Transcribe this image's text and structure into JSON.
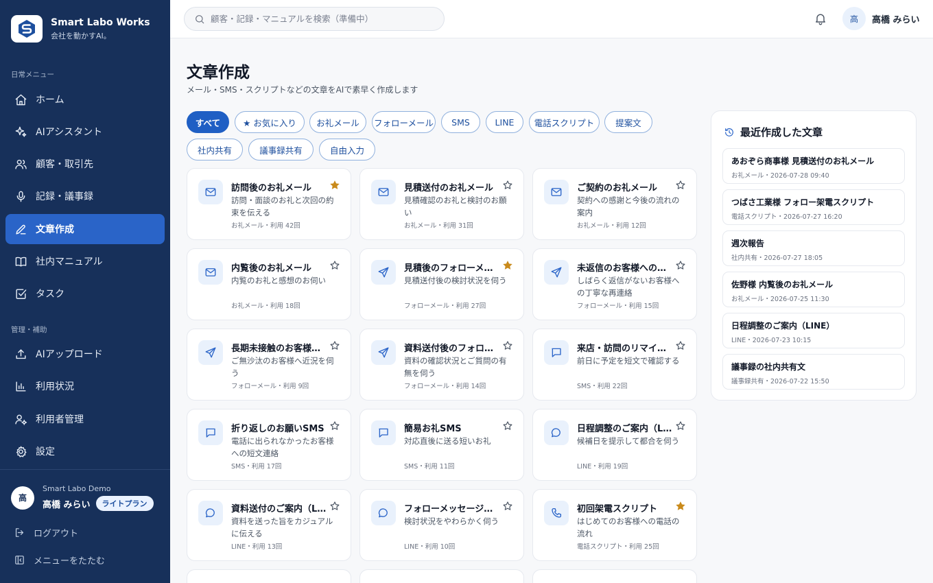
{
  "brand": {
    "title": "Smart Labo Works",
    "subtitle": "会社を動かすAI。"
  },
  "sidebar": {
    "daily_label": "日常メニュー",
    "admin_label": "管理・補助",
    "items": [
      {
        "label": "ホーム",
        "icon": "home-icon"
      },
      {
        "label": "AIアシスタント",
        "icon": "sparkles-icon"
      },
      {
        "label": "顧客・取引先",
        "icon": "users-icon"
      },
      {
        "label": "記録・議事録",
        "icon": "mic-icon"
      },
      {
        "label": "文章作成",
        "icon": "pen-icon"
      },
      {
        "label": "社内マニュアル",
        "icon": "book-icon"
      },
      {
        "label": "タスク",
        "icon": "checkbox-icon"
      }
    ],
    "admin_items": [
      {
        "label": "AIアップロード",
        "icon": "upload-icon"
      },
      {
        "label": "利用状況",
        "icon": "bar-chart-icon"
      },
      {
        "label": "利用者管理",
        "icon": "user-gear-icon"
      },
      {
        "label": "設定",
        "icon": "gear-icon"
      }
    ],
    "user": {
      "avatar": "高",
      "org": "Smart Labo Demo",
      "name": "高橋 みらい",
      "plan": "ライトプラン"
    },
    "logout": "ログアウト",
    "collapse": "メニューをたたむ"
  },
  "header": {
    "search_placeholder": "顧客・記録・マニュアルを検索（準備中）",
    "user_avatar": "高",
    "user_name": "高橋 みらい"
  },
  "main": {
    "title": "文章作成",
    "subtitle": "メール・SMS・スクリプトなどの文章をAIで素早く作成します",
    "filters": [
      "すべて",
      "★ お気に入り",
      "お礼メール",
      "フォローメール",
      "SMS",
      "LINE",
      "電話スクリプト",
      "提案文",
      "社内共有",
      "議事録共有",
      "自由入力"
    ],
    "active_filter": "すべて",
    "templates": [
      {
        "title": "訪問後のお礼メール",
        "desc": "訪問・面談のお礼と次回の約束を伝える",
        "meta": "お礼メール・利用 42回",
        "icon": "mail-icon",
        "starred": true
      },
      {
        "title": "見積送付のお礼メール",
        "desc": "見積確認のお礼と検討のお願い",
        "meta": "お礼メール・利用 31回",
        "icon": "mail-icon",
        "starred": false
      },
      {
        "title": "ご契約のお礼メール",
        "desc": "契約への感謝と今後の流れの案内",
        "meta": "お礼メール・利用 12回",
        "icon": "mail-icon",
        "starred": false
      },
      {
        "title": "内覧後のお礼メール",
        "desc": "内覧のお礼と感想のお伺い",
        "meta": "お礼メール・利用 18回",
        "icon": "mail-icon",
        "starred": false
      },
      {
        "title": "見積後のフォローメール",
        "desc": "見積送付後の検討状況を伺う",
        "meta": "フォローメール・利用 27回",
        "icon": "send-icon",
        "starred": true
      },
      {
        "title": "未返信のお客様へのフォ…",
        "desc": "しばらく返信がないお客様への丁寧な再連絡",
        "meta": "フォローメール・利用 15回",
        "icon": "send-icon",
        "starred": false
      },
      {
        "title": "長期未接触のお客様へ…",
        "desc": "ご無沙汰のお客様へ近況を伺う",
        "meta": "フォローメール・利用 9回",
        "icon": "send-icon",
        "starred": false
      },
      {
        "title": "資料送付後のフォローメ…",
        "desc": "資料の確認状況とご質問の有無を伺う",
        "meta": "フォローメール・利用 14回",
        "icon": "send-icon",
        "starred": false
      },
      {
        "title": "来店・訪問のリマインドS…",
        "desc": "前日に予定を短文で確認する",
        "meta": "SMS・利用 22回",
        "icon": "chat-square-icon",
        "starred": false
      },
      {
        "title": "折り返しのお願いSMS",
        "desc": "電話に出られなかったお客様への短文連絡",
        "meta": "SMS・利用 17回",
        "icon": "chat-square-icon",
        "starred": false
      },
      {
        "title": "簡易お礼SMS",
        "desc": "対応直後に送る短いお礼",
        "meta": "SMS・利用 11回",
        "icon": "chat-square-icon",
        "starred": false
      },
      {
        "title": "日程調整のご案内（LI…",
        "desc": "候補日を提示して都合を伺う",
        "meta": "LINE・利用 19回",
        "icon": "chat-round-icon",
        "starred": false
      },
      {
        "title": "資料送付のご案内（LI…",
        "desc": "資料を送った旨をカジュアルに伝える",
        "meta": "LINE・利用 13回",
        "icon": "chat-round-icon",
        "starred": false
      },
      {
        "title": "フォローメッセージ（LINE…",
        "desc": "検討状況をやわらかく伺う",
        "meta": "LINE・利用 10回",
        "icon": "chat-round-icon",
        "starred": false
      },
      {
        "title": "初回架電スクリプト",
        "desc": "はじめてのお客様への電話の流れ",
        "meta": "電話スクリプト・利用 25回",
        "icon": "phone-icon",
        "starred": true
      }
    ]
  },
  "recent": {
    "title": "最近作成した文章",
    "items": [
      {
        "title": "あおぞら商事様 見積送付のお礼メール",
        "meta": "お礼メール・2026-07-28 09:40"
      },
      {
        "title": "つばさ工業様 フォロー架電スクリプト",
        "meta": "電話スクリプト・2026-07-27 16:20"
      },
      {
        "title": "週次報告",
        "meta": "社内共有・2026-07-27 18:05"
      },
      {
        "title": "佐野様 内覧後のお礼メール",
        "meta": "お礼メール・2026-07-25 11:30"
      },
      {
        "title": "日程調整のご案内（LINE）",
        "meta": "LINE・2026-07-23 10:15"
      },
      {
        "title": "議事録の社内共有文",
        "meta": "議事録共有・2026-07-22 15:50"
      }
    ]
  },
  "colors": {
    "sidebar_bg": "#17305a",
    "accent": "#1f5fc4",
    "star_active": "#c98a1b"
  }
}
